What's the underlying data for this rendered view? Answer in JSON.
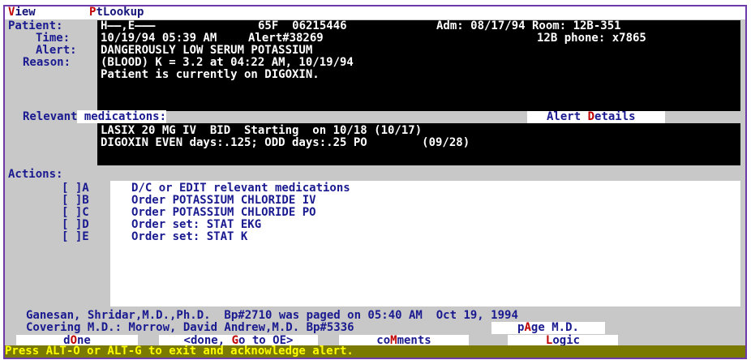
{
  "menu": [
    {
      "hot": "V",
      "rest": "iew"
    },
    {
      "hot": "P",
      "rest": "tLookup"
    }
  ],
  "header": {
    "patient_label": "Patient:",
    "patient_name": "H——,E———",
    "patient_info": "65F  06215446",
    "admission": "Adm: 08/17/94 Room: 12B-351",
    "time_label": "Time:",
    "time_value": "10/19/94 05:39 AM",
    "alert_no": "Alert#38269",
    "phone": "12B phone: x7865",
    "alert_label": "Alert:",
    "alert_value": "DANGEROUSLY LOW SERUM POTASSIUM",
    "reason_label": "Reason:",
    "reason_line1": "(BLOOD) K = 3.2 at 04:22 AM, 10/19/94",
    "reason_line2": "Patient is currently on DIGOXIN."
  },
  "meds": {
    "label_a": "Relevant",
    "label_b": " medications:",
    "details_a": "Alert ",
    "details_hot": "D",
    "details_b": "etails",
    "lines": [
      "LASIX 20 MG IV  BID  Starting  on 10/18 (10/17)",
      "DIGOXIN EVEN days:.125; ODD days:.25 PO        (09/28)"
    ]
  },
  "actions": {
    "label": "Actions:",
    "items": [
      {
        "box": "[ ]",
        "key": "A",
        "text": "D/C or EDIT relevant medications"
      },
      {
        "box": "[ ]",
        "key": "B",
        "text": "Order POTASSIUM CHLORIDE IV"
      },
      {
        "box": "[ ]",
        "key": "C",
        "text": "Order POTASSIUM CHLORIDE PO"
      },
      {
        "box": "[ ]",
        "key": "D",
        "text": "Order set: STAT EKG"
      },
      {
        "box": "[ ]",
        "key": "E",
        "text": "Order set: STAT K"
      }
    ]
  },
  "footer": {
    "line1": "Ganesan, Shridar,M.D.,Ph.D.  Bp#2710 was paged on 05:40 AM  Oct 19, 1994",
    "covering": "Covering M.D.: Morrow, David Andrew,M.D. Bp#5336",
    "page_md": {
      "a": "p",
      "hot": "A",
      "b": "ge M.D."
    }
  },
  "buttons": {
    "done": {
      "a": "d",
      "hot": "O",
      "b": "ne"
    },
    "done_go": {
      "a": "<done, ",
      "hot": "G",
      "b": "o to OE>"
    },
    "comments": {
      "a": "co",
      "hot": "M",
      "b": "ments"
    },
    "logic": {
      "a": "",
      "hot": "L",
      "b": "ogic"
    }
  },
  "status": "Press ALT-O or ALT-G to exit and acknowledge alert.",
  "colors": {
    "frame": "#6e39a8",
    "label": "#1a1a90",
    "hotkey": "#c00000",
    "status_bg": "#7a7a00",
    "status_text": "#ffff00"
  }
}
